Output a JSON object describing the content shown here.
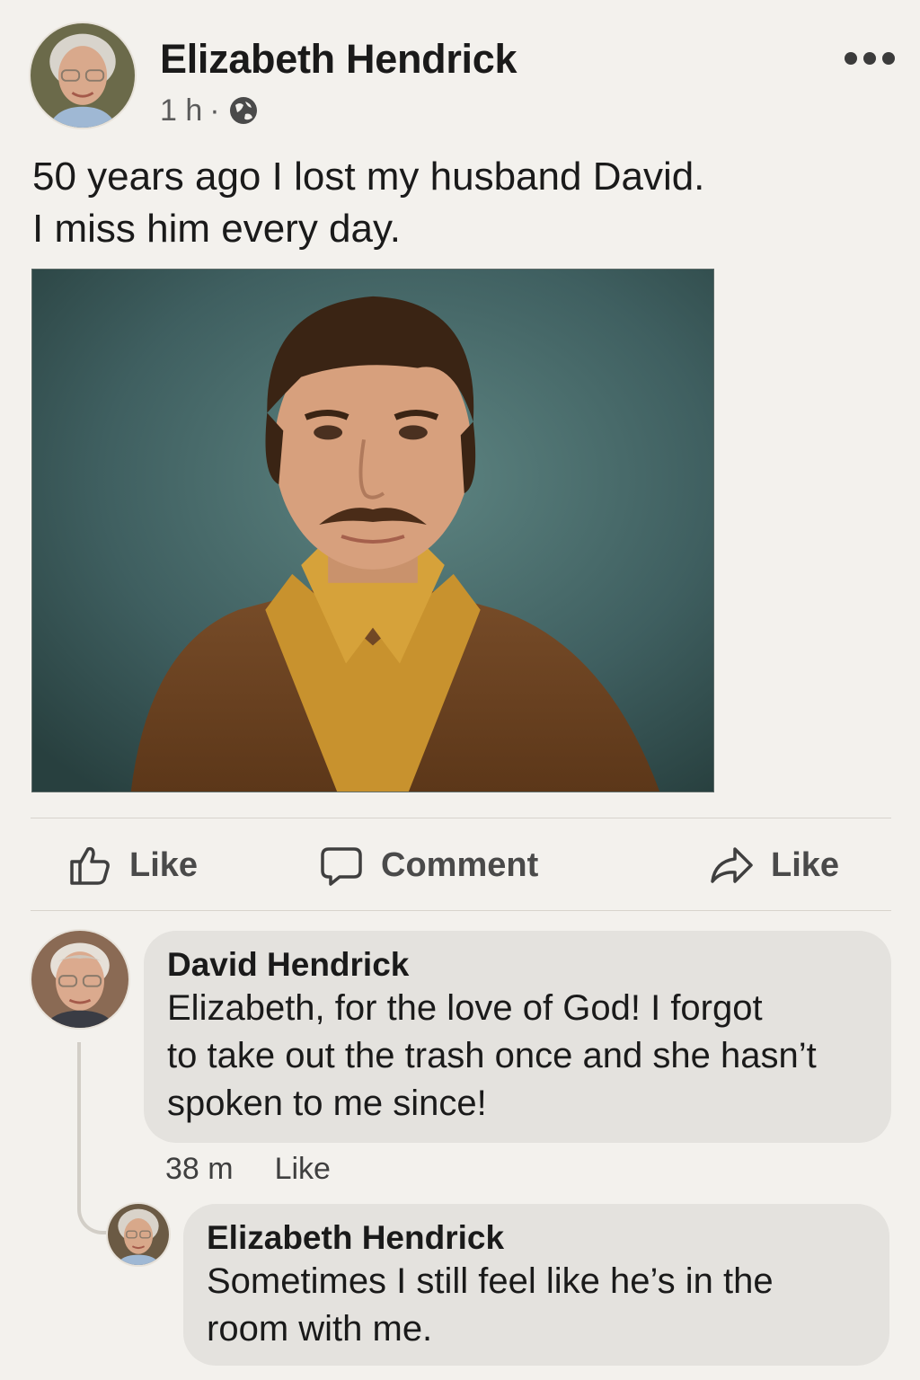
{
  "post": {
    "author": "Elizabeth Hendrick",
    "time": "1 h",
    "separator": "·",
    "privacy_icon": "globe-icon",
    "more_icon": "more-dots-icon",
    "text_lines": [
      "50 years ago I lost my husband David.",
      "I miss him every day."
    ],
    "photo": "portrait photo of a young man with a mustache in a brown jacket and mustard shirt"
  },
  "actions": [
    {
      "icon": "thumbs-up-icon",
      "label": "Like"
    },
    {
      "icon": "comment-icon",
      "label": "Comment"
    },
    {
      "icon": "share-arrow-icon",
      "label": "Like"
    }
  ],
  "comments": [
    {
      "author": "David Hendrick",
      "text_lines": [
        "Elizabeth, for the love of God! I forgot",
        "to take out the trash once and she hasn’t",
        "spoken to me since!"
      ],
      "time": "38 m",
      "like_label": "Like"
    },
    {
      "author": "Elizabeth Hendrick",
      "text_lines": [
        "Sometimes I still feel like he’s in the",
        "room with me."
      ]
    }
  ],
  "colors": {
    "background": "#f3f1ed",
    "bubble": "#e4e2de",
    "text": "#1a1a1a",
    "secondary_text": "#4a4a4a"
  }
}
